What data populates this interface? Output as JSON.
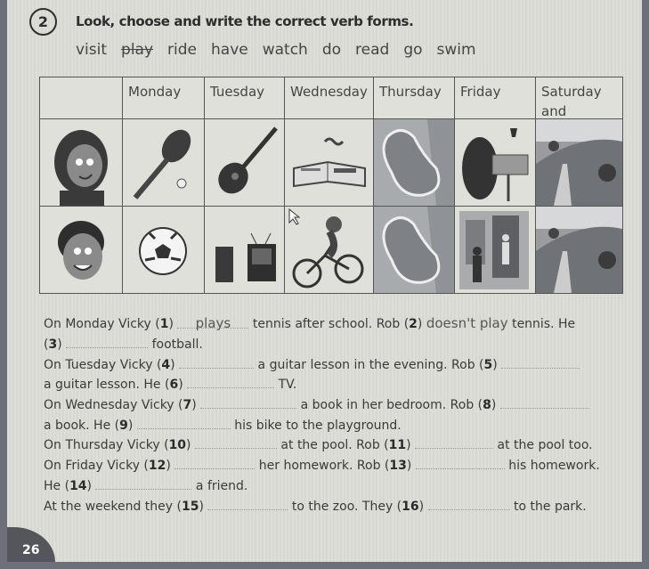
{
  "exercise": {
    "number": "2",
    "instruction": "Look, choose and write the correct verb forms.",
    "word_bank": [
      {
        "word": "visit",
        "crossed_out": false
      },
      {
        "word": "play",
        "crossed_out": true
      },
      {
        "word": "ride",
        "crossed_out": false
      },
      {
        "word": "have",
        "crossed_out": false
      },
      {
        "word": "watch",
        "crossed_out": false
      },
      {
        "word": "do",
        "crossed_out": false
      },
      {
        "word": "read",
        "crossed_out": false
      },
      {
        "word": "go",
        "crossed_out": false
      },
      {
        "word": "swim",
        "crossed_out": false
      }
    ]
  },
  "table": {
    "headers": [
      "",
      "Monday",
      "Tuesday",
      "Wednesday",
      "Thursday",
      "Friday",
      "Saturday and Sunday"
    ],
    "rows": [
      {
        "person": "Vicky",
        "pictures": [
          "girl-portrait",
          "tennis-racket-and-ball",
          "guitar",
          "open-book-and-glasses",
          "swimming-pool",
          "girl-doing-homework",
          "park-landscape"
        ]
      },
      {
        "person": "Rob",
        "pictures": [
          "boy-portrait",
          "football",
          "boy-watching-tv",
          "boy-riding-bike",
          "swimming-pool",
          "visiting-friend-at-door",
          "park-landscape"
        ]
      }
    ]
  },
  "sentences": {
    "l1a": "On Monday Vicky (",
    "n1": "1",
    "a1": "plays",
    "l1b": "tennis after school. Rob (",
    "n2": "2",
    "a2": "doesn't play",
    "l1c": "tennis. He",
    "n3": "3",
    "l2b": "football.",
    "l3a": "On Tuesday Vicky (",
    "n4": "4",
    "l3b": "a guitar lesson in the evening. Rob (",
    "n5": "5",
    "l4a": "a guitar lesson. He (",
    "n6": "6",
    "l4b": "TV.",
    "l5a": "On Wednesday Vicky (",
    "n7": "7",
    "l5b": "a book in her bedroom. Rob (",
    "n8": "8",
    "l6a": "a book. He (",
    "n9": "9",
    "l6b": "his bike to the playground.",
    "l7a": "On Thursday Vicky (",
    "n10": "10",
    "l7b": "at the pool. Rob (",
    "n11": "11",
    "l7c": "at the pool too.",
    "l8a": "On Friday Vicky (",
    "n12": "12",
    "l8b": "her homework. Rob (",
    "n13": "13",
    "l8c": "his homework.",
    "l9a": "He (",
    "n14": "14",
    "l9b": "a friend.",
    "l10a": "At the weekend they (",
    "n15": "15",
    "l10b": "to the zoo. They (",
    "n16": "16",
    "l10c": "to the park.",
    "close": ")"
  },
  "page_number": "26"
}
